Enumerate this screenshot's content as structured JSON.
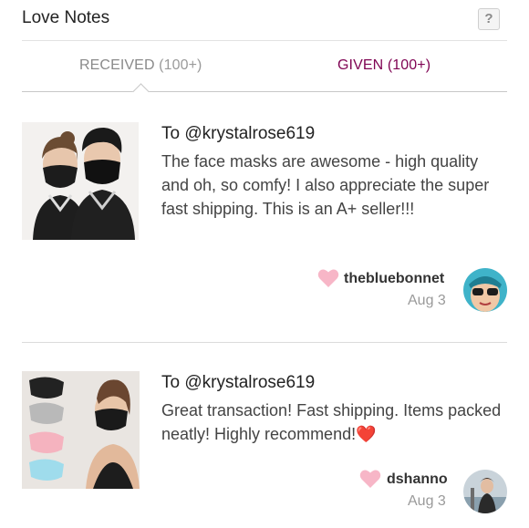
{
  "header": {
    "title": "Love Notes",
    "help_label": "?"
  },
  "tabs": [
    {
      "label": "RECEIVED",
      "count": "(100+)",
      "active": true
    },
    {
      "label": "GIVEN (100+)",
      "active": false
    }
  ],
  "notes": [
    {
      "to": "To @krystalrose619",
      "text": "The face masks are awesome - high quality and oh, so comfy! I also appreciate the super fast shipping. This is an A+ seller!!!",
      "user": "thebluebonnet",
      "date": "Aug 3"
    },
    {
      "to": "To @krystalrose619",
      "text": "Great transaction! Fast shipping. Items packed neatly! Highly recommend!❤️",
      "user": "dshanno",
      "date": "Aug 3"
    }
  ],
  "colors": {
    "accent": "#7f0353",
    "heart": "#f7b6c7",
    "muted": "#9a9a9a"
  }
}
